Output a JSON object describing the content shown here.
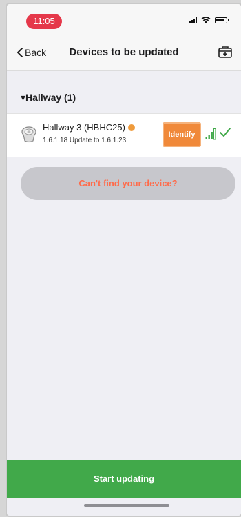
{
  "status_bar": {
    "time": "11:05"
  },
  "nav": {
    "back_label": "Back",
    "title": "Devices to be updated"
  },
  "section": {
    "title": "▾Hallway (1)"
  },
  "device": {
    "name": "Hallway 3 (HBHC25)",
    "version_text": "1.6.1.18 Update to 1.6.1.23",
    "identify_label": "Identify",
    "status_color": "#ef9b3c"
  },
  "cant_find_label": "Can't find your device?",
  "start_label": "Start updating",
  "colors": {
    "accent_green": "#41a94a",
    "identify_orange": "#f0893a",
    "cant_find_text": "#ff6b4a",
    "time_pill": "#e5384a"
  }
}
